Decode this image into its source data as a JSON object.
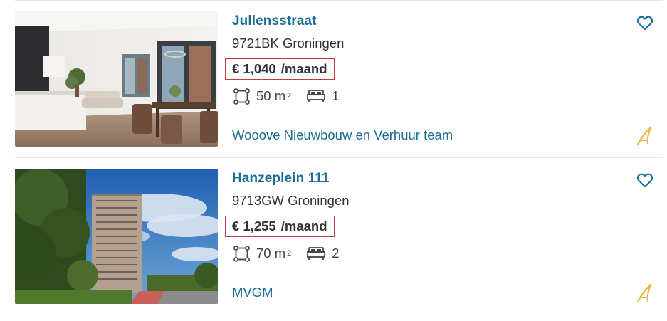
{
  "listings": [
    {
      "title": "Jullensstraat",
      "address": "9721BK Groningen",
      "price": "€ 1,040",
      "price_unit": "/maand",
      "area_value": "50 m",
      "area_sup": "2",
      "bedrooms": "1",
      "agent": "Wooove Nieuwbouw en Verhuur team",
      "favorite_icon": "heart-outline-icon",
      "agent_logo_icon": "agent-logo-icon"
    },
    {
      "title": "Hanzeplein 111",
      "address": "9713GW Groningen",
      "price": "€ 1,255",
      "price_unit": "/maand",
      "area_value": "70 m",
      "area_sup": "2",
      "bedrooms": "2",
      "agent": "MVGM",
      "favorite_icon": "heart-outline-icon",
      "agent_logo_icon": "agent-logo-icon"
    }
  ],
  "colors": {
    "link": "#1a6e96",
    "text": "#333333",
    "highlight_border": "#c0393b",
    "agent_logo": "#e8b84a"
  }
}
